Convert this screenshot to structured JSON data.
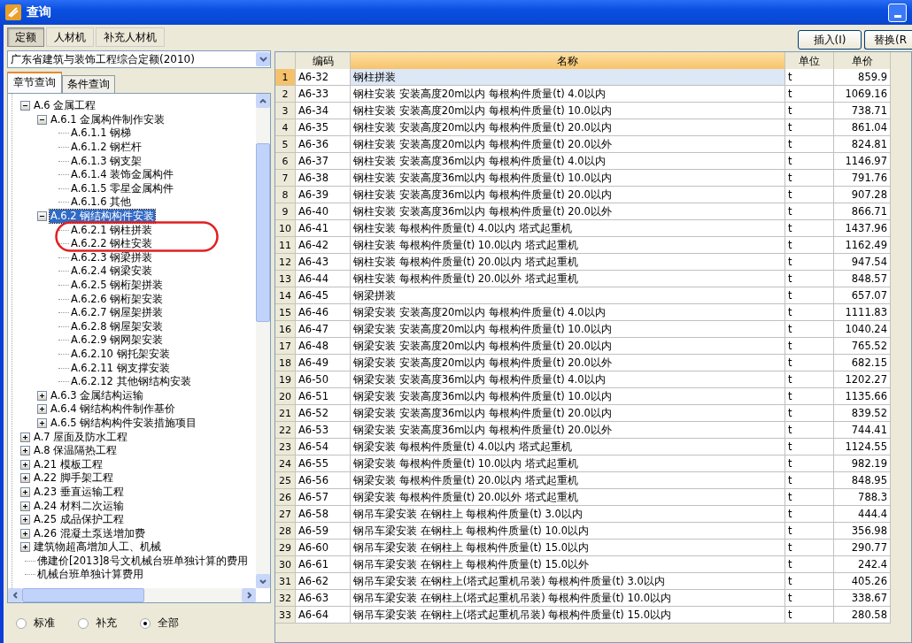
{
  "window": {
    "title": "查询"
  },
  "top_tabs": [
    {
      "label": "定额",
      "selected": true
    },
    {
      "label": "人材机",
      "selected": false
    },
    {
      "label": "补充人材机",
      "selected": false
    }
  ],
  "quota_select": {
    "value": "广东省建筑与装饰工程综合定额(2010)"
  },
  "sub_tabs": [
    {
      "label": "章节查询",
      "selected": true
    },
    {
      "label": "条件查询",
      "selected": false
    }
  ],
  "tree": [
    {
      "label": "A.6 金属工程",
      "expanded": true,
      "selected": false,
      "children": [
        {
          "label": "A.6.1 金属构件制作安装",
          "expanded": true,
          "selected": false,
          "children": [
            {
              "label": "A.6.1.1 钢梯",
              "selected": false
            },
            {
              "label": "A.6.1.2 钢栏杆",
              "selected": false
            },
            {
              "label": "A.6.1.3 钢支架",
              "selected": false
            },
            {
              "label": "A.6.1.4 装饰金属构件",
              "selected": false
            },
            {
              "label": "A.6.1.5 零星金属构件",
              "selected": false
            },
            {
              "label": "A.6.1.6 其他",
              "selected": false
            }
          ]
        },
        {
          "label": "A.6.2 钢结构构件安装",
          "expanded": true,
          "selected": true,
          "children": [
            {
              "label": "A.6.2.1 钢柱拼装",
              "selected": false
            },
            {
              "label": "A.6.2.2 钢柱安装",
              "selected": false
            },
            {
              "label": "A.6.2.3 钢梁拼装",
              "selected": false
            },
            {
              "label": "A.6.2.4 钢梁安装",
              "selected": false
            },
            {
              "label": "A.6.2.5 钢桁架拼装",
              "selected": false
            },
            {
              "label": "A.6.2.6 钢桁架安装",
              "selected": false
            },
            {
              "label": "A.6.2.7 钢屋架拼装",
              "selected": false
            },
            {
              "label": "A.6.2.8 钢屋架安装",
              "selected": false
            },
            {
              "label": "A.6.2.9 钢网架安装",
              "selected": false
            },
            {
              "label": "A.6.2.10 钢托架安装",
              "selected": false
            },
            {
              "label": "A.6.2.11 钢支撑安装",
              "selected": false
            },
            {
              "label": "A.6.2.12 其他钢结构安装",
              "selected": false
            }
          ]
        },
        {
          "label": "A.6.3 金属结构运输",
          "expanded": false,
          "selected": false
        },
        {
          "label": "A.6.4 钢结构构件制作基价",
          "expanded": false,
          "selected": false
        },
        {
          "label": "A.6.5 钢结构构件安装措施项目",
          "expanded": false,
          "selected": false
        }
      ]
    },
    {
      "label": "A.7 屋面及防水工程",
      "expanded": false,
      "selected": false
    },
    {
      "label": "A.8 保温隔热工程",
      "expanded": false,
      "selected": false
    },
    {
      "label": "A.21 模板工程",
      "expanded": false,
      "selected": false
    },
    {
      "label": "A.22 脚手架工程",
      "expanded": false,
      "selected": false
    },
    {
      "label": "A.23 垂直运输工程",
      "expanded": false,
      "selected": false
    },
    {
      "label": "A.24 材料二次运输",
      "expanded": false,
      "selected": false
    },
    {
      "label": "A.25 成品保护工程",
      "expanded": false,
      "selected": false
    },
    {
      "label": "A.26 混凝土泵送增加费",
      "expanded": false,
      "selected": false
    },
    {
      "label": "建筑物超高增加人工、机械",
      "expanded": false,
      "selected": false
    },
    {
      "label": "佛建价[2013]8号文机械台班单独计算的费用",
      "selected": false
    },
    {
      "label": "机械台班单独计算费用",
      "selected": false
    }
  ],
  "filter_radios": [
    {
      "label": "标准",
      "selected": false
    },
    {
      "label": "补充",
      "selected": false
    },
    {
      "label": "全部",
      "selected": true
    }
  ],
  "toolbar_buttons": [
    "插入(I)",
    "替换(R"
  ],
  "table": {
    "columns": [
      {
        "label": "编码",
        "selected": false
      },
      {
        "label": "名称",
        "selected": true
      },
      {
        "label": "单位",
        "selected": false
      },
      {
        "label": "单价",
        "selected": false
      }
    ],
    "rows": [
      {
        "index": "1",
        "code": "A6-32",
        "name": "钢柱拼装",
        "unit": "t",
        "price": "859.9",
        "selected": true
      },
      {
        "index": "2",
        "code": "A6-33",
        "name": "钢柱安装 安装高度20m以内 每根构件质量(t) 4.0以内",
        "unit": "t",
        "price": "1069.16",
        "selected": false
      },
      {
        "index": "3",
        "code": "A6-34",
        "name": "钢柱安装 安装高度20m以内 每根构件质量(t) 10.0以内",
        "unit": "t",
        "price": "738.71",
        "selected": false
      },
      {
        "index": "4",
        "code": "A6-35",
        "name": "钢柱安装 安装高度20m以内 每根构件质量(t) 20.0以内",
        "unit": "t",
        "price": "861.04",
        "selected": false
      },
      {
        "index": "5",
        "code": "A6-36",
        "name": "钢柱安装 安装高度20m以内 每根构件质量(t) 20.0以外",
        "unit": "t",
        "price": "824.81",
        "selected": false
      },
      {
        "index": "6",
        "code": "A6-37",
        "name": "钢柱安装 安装高度36m以内 每根构件质量(t) 4.0以内",
        "unit": "t",
        "price": "1146.97",
        "selected": false
      },
      {
        "index": "7",
        "code": "A6-38",
        "name": "钢柱安装 安装高度36m以内 每根构件质量(t) 10.0以内",
        "unit": "t",
        "price": "791.76",
        "selected": false
      },
      {
        "index": "8",
        "code": "A6-39",
        "name": "钢柱安装 安装高度36m以内 每根构件质量(t) 20.0以内",
        "unit": "t",
        "price": "907.28",
        "selected": false
      },
      {
        "index": "9",
        "code": "A6-40",
        "name": "钢柱安装 安装高度36m以内 每根构件质量(t) 20.0以外",
        "unit": "t",
        "price": "866.71",
        "selected": false
      },
      {
        "index": "10",
        "code": "A6-41",
        "name": "钢柱安装 每根构件质量(t) 4.0以内 塔式起重机",
        "unit": "t",
        "price": "1437.96",
        "selected": false
      },
      {
        "index": "11",
        "code": "A6-42",
        "name": "钢柱安装 每根构件质量(t) 10.0以内 塔式起重机",
        "unit": "t",
        "price": "1162.49",
        "selected": false
      },
      {
        "index": "12",
        "code": "A6-43",
        "name": "钢柱安装 每根构件质量(t) 20.0以内 塔式起重机",
        "unit": "t",
        "price": "947.54",
        "selected": false
      },
      {
        "index": "13",
        "code": "A6-44",
        "name": "钢柱安装 每根构件质量(t) 20.0以外 塔式起重机",
        "unit": "t",
        "price": "848.57",
        "selected": false
      },
      {
        "index": "14",
        "code": "A6-45",
        "name": "钢梁拼装",
        "unit": "t",
        "price": "657.07",
        "selected": false
      },
      {
        "index": "15",
        "code": "A6-46",
        "name": "钢梁安装 安装高度20m以内 每根构件质量(t) 4.0以内",
        "unit": "t",
        "price": "1111.83",
        "selected": false
      },
      {
        "index": "16",
        "code": "A6-47",
        "name": "钢梁安装 安装高度20m以内 每根构件质量(t) 10.0以内",
        "unit": "t",
        "price": "1040.24",
        "selected": false
      },
      {
        "index": "17",
        "code": "A6-48",
        "name": "钢梁安装 安装高度20m以内 每根构件质量(t) 20.0以内",
        "unit": "t",
        "price": "765.52",
        "selected": false
      },
      {
        "index": "18",
        "code": "A6-49",
        "name": "钢梁安装 安装高度20m以内 每根构件质量(t) 20.0以外",
        "unit": "t",
        "price": "682.15",
        "selected": false
      },
      {
        "index": "19",
        "code": "A6-50",
        "name": "钢梁安装 安装高度36m以内 每根构件质量(t) 4.0以内",
        "unit": "t",
        "price": "1202.27",
        "selected": false
      },
      {
        "index": "20",
        "code": "A6-51",
        "name": "钢梁安装 安装高度36m以内 每根构件质量(t) 10.0以内",
        "unit": "t",
        "price": "1135.66",
        "selected": false
      },
      {
        "index": "21",
        "code": "A6-52",
        "name": "钢梁安装 安装高度36m以内 每根构件质量(t) 20.0以内",
        "unit": "t",
        "price": "839.52",
        "selected": false
      },
      {
        "index": "22",
        "code": "A6-53",
        "name": "钢梁安装 安装高度36m以内 每根构件质量(t) 20.0以外",
        "unit": "t",
        "price": "744.41",
        "selected": false
      },
      {
        "index": "23",
        "code": "A6-54",
        "name": "钢梁安装 每根构件质量(t) 4.0以内 塔式起重机",
        "unit": "t",
        "price": "1124.55",
        "selected": false
      },
      {
        "index": "24",
        "code": "A6-55",
        "name": "钢梁安装 每根构件质量(t) 10.0以内 塔式起重机",
        "unit": "t",
        "price": "982.19",
        "selected": false
      },
      {
        "index": "25",
        "code": "A6-56",
        "name": "钢梁安装 每根构件质量(t) 20.0以内 塔式起重机",
        "unit": "t",
        "price": "848.95",
        "selected": false
      },
      {
        "index": "26",
        "code": "A6-57",
        "name": "钢梁安装 每根构件质量(t) 20.0以外 塔式起重机",
        "unit": "t",
        "price": "788.3",
        "selected": false
      },
      {
        "index": "27",
        "code": "A6-58",
        "name": "钢吊车梁安装 在钢柱上 每根构件质量(t) 3.0以内",
        "unit": "t",
        "price": "444.4",
        "selected": false
      },
      {
        "index": "28",
        "code": "A6-59",
        "name": "钢吊车梁安装 在钢柱上 每根构件质量(t) 10.0以内",
        "unit": "t",
        "price": "356.98",
        "selected": false
      },
      {
        "index": "29",
        "code": "A6-60",
        "name": "钢吊车梁安装 在钢柱上 每根构件质量(t) 15.0以内",
        "unit": "t",
        "price": "290.77",
        "selected": false
      },
      {
        "index": "30",
        "code": "A6-61",
        "name": "钢吊车梁安装 在钢柱上 每根构件质量(t) 15.0以外",
        "unit": "t",
        "price": "242.4",
        "selected": false
      },
      {
        "index": "31",
        "code": "A6-62",
        "name": "钢吊车梁安装 在钢柱上(塔式起重机吊装) 每根构件质量(t) 3.0以内",
        "unit": "t",
        "price": "405.26",
        "selected": false
      },
      {
        "index": "32",
        "code": "A6-63",
        "name": "钢吊车梁安装 在钢柱上(塔式起重机吊装) 每根构件质量(t) 10.0以内",
        "unit": "t",
        "price": "338.67",
        "selected": false
      },
      {
        "index": "33",
        "code": "A6-64",
        "name": "钢吊车梁安装 在钢柱上(塔式起重机吊装) 每根构件质量(t) 15.0以内",
        "unit": "t",
        "price": "280.58",
        "selected": false
      }
    ]
  }
}
